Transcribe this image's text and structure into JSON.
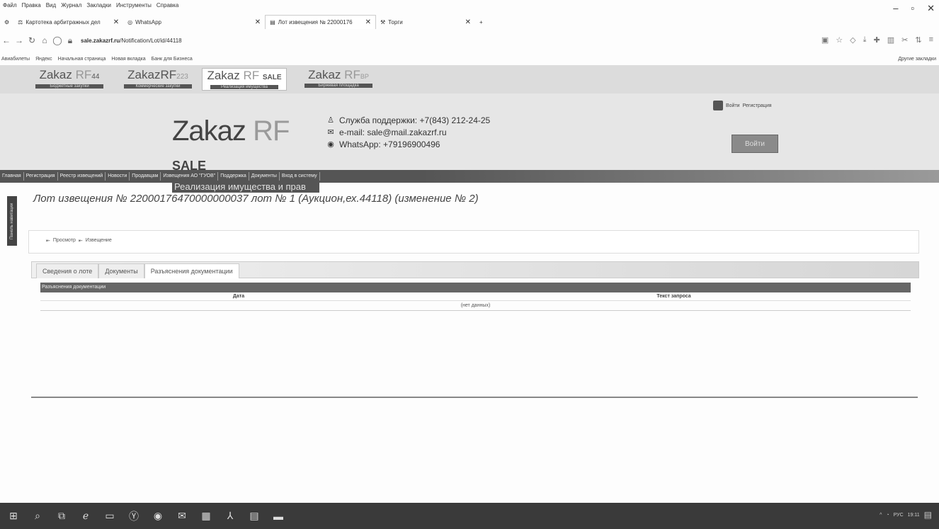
{
  "browser": {
    "menu": [
      "Файл",
      "Правка",
      "Вид",
      "Журнал",
      "Закладки",
      "Инструменты",
      "Справка"
    ],
    "tabs": [
      {
        "label": "Картотека арбитражных дел",
        "active": false
      },
      {
        "label": "WhatsApp",
        "active": false
      },
      {
        "label": "Лот извещения № 22000176",
        "active": true
      },
      {
        "label": "Торги",
        "active": false
      }
    ],
    "url_host": "sale.zakazrf.ru",
    "url_path": "/Notification/Lot/id/44118",
    "bookmarks": [
      "Авиабилеты",
      "Яндекс",
      "Начальная страница",
      "Новая вкладка",
      "Банк для Бизнеса"
    ],
    "other_bookmarks": "Другие закладки"
  },
  "sites": [
    {
      "name": "Zakaz",
      "rf": "RF",
      "suffix": "44",
      "sub": "Бюджетные закупки"
    },
    {
      "name": "ZakazRF",
      "rf": "",
      "suffix": "223",
      "sub": "Коммерческие закупки"
    },
    {
      "name": "Zakaz",
      "rf": "RF",
      "suffix": "SALE",
      "sub": "Реализация имущества"
    },
    {
      "name": "Zakaz",
      "rf": "RF",
      "suffix": "BP",
      "sub": "Биржевая площадка"
    }
  ],
  "header": {
    "login_text": "Войти",
    "login_text2": "Регистрация",
    "logo_main": "Zakaz",
    "logo_rf": "RF",
    "logo_sale": "SALE",
    "slogan": "Реализация имущества и прав",
    "support": "Служба поддержки: +7(843) 212-24-25",
    "email": "e-mail: sale@mail.zakazrf.ru",
    "whatsapp": "WhatsApp: +79196900496",
    "enter_button": "Войти"
  },
  "nav": [
    "Главная",
    "Регистрация",
    "Реестр извещений",
    "Новости",
    "Продавцам",
    "Извещения АО \"ГУОВ\"",
    "Поддержка",
    "Документы",
    "Вход в систему"
  ],
  "side_tab": "Панель навигации",
  "page_title": "Лот извещения № 22000176470000000037 лот № 1 (Аукцион,ех.44118) (изменение № 2)",
  "breadcrumbs": [
    "Просмотр",
    "Извещение"
  ],
  "panel_tabs": [
    {
      "label": "Сведения о лоте",
      "active": false
    },
    {
      "label": "Документы",
      "active": false
    },
    {
      "label": "Разъяснения документации",
      "active": true
    }
  ],
  "grid": {
    "title": "Разъяснения документации",
    "columns": [
      "Дата",
      "Текст запроса"
    ],
    "empty": "(нет данных)"
  },
  "taskbar": {
    "tray_lang": "РУС",
    "time": "19:11"
  }
}
